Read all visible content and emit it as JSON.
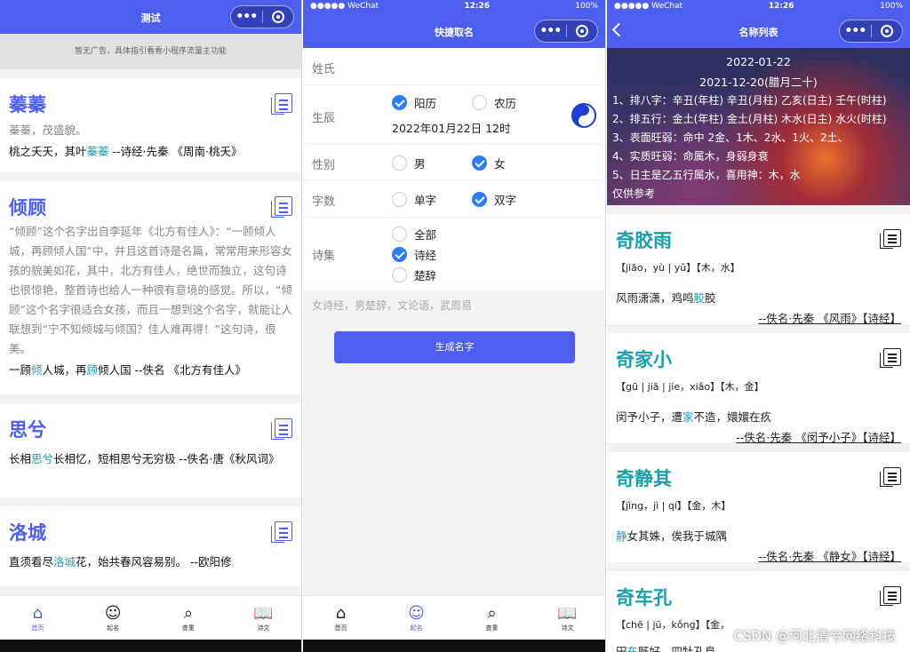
{
  "colors": {
    "brand": "#4e5ff0",
    "highlight": "#21a0b8",
    "name_teal": "#1aa0a8",
    "check_blue": "#2b7cf6"
  },
  "screen1": {
    "nav_title": "测试",
    "ad_text": "暂无广告，具体指引看看小程序流量主功能",
    "cards": [
      {
        "name": "蓁蓁",
        "desc": "蓁蓁，茂盛貌。",
        "verse_a": "桃之夭夭，其叶",
        "verse_hl": "蓁蓁",
        "verse_b": "  --诗经·先秦  《周南·桃夭》"
      },
      {
        "name": "倾顾",
        "desc": "“倾顾”这个名字出自李延年《北方有佳人》：“一顾倾人城，再顾倾人国”中，并且这首诗是名篇，常常用来形容女孩的貌美如花，其中，北方有佳人，绝世而独立，这句诗也很惊艳，整首诗也给人一种很有意境的感觉。所以，“倾顾”这个名字很适合女孩，而且一想到这个名字，就能让人联想到“宁不知倾城与倾国？佳人难再得！”这句诗，很美。",
        "verse_a": "一顾",
        "verse_hl": "倾",
        "verse_b": "人城，再",
        "verse_hl2": "顾",
        "verse_c": "倾人国  --佚名  《北方有佳人》"
      },
      {
        "name": "思兮",
        "verse_a": "长相",
        "verse_hl": "思兮",
        "verse_b": "长相忆，短相思兮无穷极  --佚名·唐《秋风词》"
      },
      {
        "name": "洛城",
        "verse_a": "直须看尽",
        "verse_hl": "洛城",
        "verse_b": "花，始共春风容易别。  --欧阳修"
      }
    ],
    "tabs": [
      {
        "label": "首页",
        "icon": "home-icon",
        "glyph": "⌂"
      },
      {
        "label": "起名",
        "icon": "baby-face-icon",
        "glyph": "☺"
      },
      {
        "label": "查重",
        "icon": "search-icon",
        "glyph": "⌕"
      },
      {
        "label": "诗文",
        "icon": "book-icon",
        "glyph": "📖"
      }
    ]
  },
  "screen2": {
    "status": {
      "carrier": "●●●●● WeChat",
      "time": "12:26",
      "battery": "100%"
    },
    "nav_title": "快捷取名",
    "surname_label": "姓氏",
    "birth_label": "生辰",
    "solar_label": "阳历",
    "lunar_label": "农历",
    "birth_value": "2022年01月22日 12时",
    "gender_label": "性别",
    "male_label": "男",
    "female_label": "女",
    "count_label": "字数",
    "single_label": "单字",
    "double_label": "双字",
    "poetry_label": "诗集",
    "all_label": "全部",
    "shijing_label": "诗经",
    "chuci_label": "楚辞",
    "hint": "女诗经，男楚辞，文论语，武周易",
    "generate_label": "生成名字",
    "tabs": [
      {
        "label": "首页",
        "icon": "home-icon",
        "glyph": "⌂"
      },
      {
        "label": "起名",
        "icon": "baby-face-icon",
        "glyph": "☺"
      },
      {
        "label": "查重",
        "icon": "search-icon",
        "glyph": "⌕"
      },
      {
        "label": "诗文",
        "icon": "book-icon",
        "glyph": "📖"
      }
    ]
  },
  "screen3": {
    "status": {
      "carrier": "●●●●● WeChat",
      "time": "12:26",
      "battery": "100%"
    },
    "nav_title": "名称列表",
    "banner": {
      "date1": "2022-01-22",
      "date2": "2021-12-20(腊月二十)",
      "lines": [
        "1、排八字：辛丑(年柱) 辛丑(月柱) 乙亥(日主) 壬午(时柱)",
        "2、排五行：金土(年柱) 金土(月柱) 木水(日主) 水火(时柱)",
        "3、表面旺弱：命中 2金、1木、2水、1火、2土、",
        "4、实质旺弱：命属木，身弱身衰",
        "5、日主是乙五行属水，喜用神：木，水"
      ],
      "note": "仅供参考"
    },
    "names": [
      {
        "name": "奇胶雨",
        "pinyin": "【jiāo，yù | yǔ】【木，水】",
        "line_a": "风雨潇潇，鸡鸣",
        "line_hl": "胶",
        "line_b": "胶",
        "source": "--佚名·先秦 《风雨》【诗经】"
      },
      {
        "name": "奇家小",
        "pinyin": "【gū | jiā | jie，xiǎo】【木，金】",
        "line_a": "闵予小子，遭",
        "line_hl": "家",
        "line_b": "不造，嬛嬛在疚",
        "source": "--佚名·先秦 《闵予小子》【诗经】"
      },
      {
        "name": "奇静其",
        "pinyin": "【jìng，jì | qí】【金，木】",
        "line_a": "",
        "line_hl": "静",
        "line_b": "女其姝，俟我于城隅",
        "source": "--佚名·先秦 《静女》【诗经】"
      },
      {
        "name": "奇车孔",
        "pinyin": "【chē | jū，kǒng】【金，",
        "line_a": "田",
        "line_hl": "车",
        "line_b": "既好，四牡孔阜",
        "source": ""
      }
    ],
    "watermark": "CSDN @河北清兮网络科技"
  }
}
